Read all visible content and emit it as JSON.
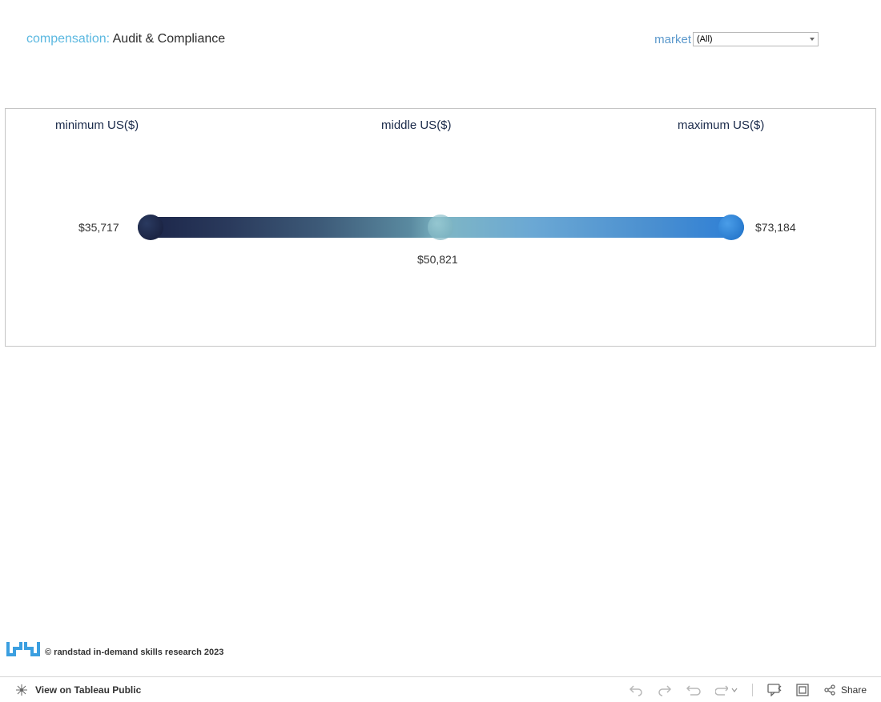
{
  "header": {
    "title_label": "compensation: ",
    "title_value": "Audit & Compliance",
    "market_label": "market",
    "market_selected": "(All)"
  },
  "columns": {
    "min": "minimum US($)",
    "mid": "middle US($)",
    "max": "maximum US($)"
  },
  "values": {
    "min": "$35,717",
    "mid": "$50,821",
    "max": "$73,184"
  },
  "footer": {
    "copyright": "© randstad in-demand skills research 2023"
  },
  "toolbar": {
    "view_label": "View on Tableau Public",
    "share_label": "Share"
  },
  "chart_data": {
    "type": "bar",
    "title": "compensation: Audit & Compliance",
    "categories": [
      "minimum US($)",
      "middle US($)",
      "maximum US($)"
    ],
    "values": [
      35717,
      50821,
      73184
    ],
    "xlabel": "",
    "ylabel": "US($)",
    "ylim": [
      30000,
      80000
    ]
  }
}
